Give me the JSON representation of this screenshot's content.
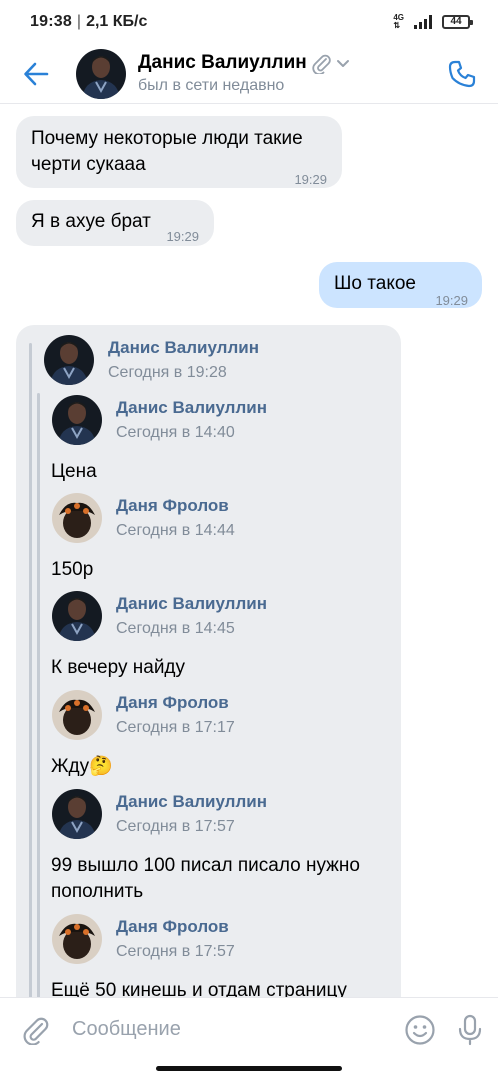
{
  "statusbar": {
    "time": "19:38",
    "speed": "2,1 КБ/с",
    "network": "4G",
    "battery": "44"
  },
  "header": {
    "name": "Данис Валиуллин",
    "status": "был в сети недавно"
  },
  "messages": [
    {
      "direction": "in",
      "line1": "Почему некоторые люди такие",
      "line2": "черти сукааа",
      "time": "19:29"
    },
    {
      "direction": "in",
      "text": "Я в ахуе брат",
      "time": "19:29"
    },
    {
      "direction": "out",
      "text": "Шо такое",
      "time": "19:29"
    }
  ],
  "forwarded": {
    "outer": {
      "name": "Данис Валиуллин",
      "date": "Сегодня в 19:28"
    },
    "items": [
      {
        "name": "Данис Валиуллин",
        "date": "Сегодня в 14:40",
        "text": "Цена"
      },
      {
        "name": "Даня Фролов",
        "date": "Сегодня в 14:44",
        "text": "150р"
      },
      {
        "name": "Данис Валиуллин",
        "date": "Сегодня в 14:45",
        "text": "К вечеру найду"
      },
      {
        "name": "Даня Фролов",
        "date": "Сегодня в 17:17",
        "text": "Жду🤔"
      },
      {
        "name": "Данис Валиуллин",
        "date": "Сегодня в 17:57",
        "line1": "99 вышло 100 писал писало нужно",
        "line2": "пополнить"
      },
      {
        "name": "Даня Фролов",
        "date": "Сегодня в 17:57",
        "text": "Ещё 50 кинешь и отдам страницу"
      }
    ]
  },
  "composer": {
    "placeholder": "Сообщение"
  },
  "colors": {
    "accent": "#2a81d7",
    "link_name": "#4a6a91",
    "in_bubble": "#ebedf0",
    "out_bubble": "#cce4ff"
  },
  "icons": [
    "back-arrow-icon",
    "paperclip-icon",
    "chevron-down-icon",
    "phone-icon",
    "attach-icon",
    "emoji-icon",
    "mic-icon"
  ]
}
